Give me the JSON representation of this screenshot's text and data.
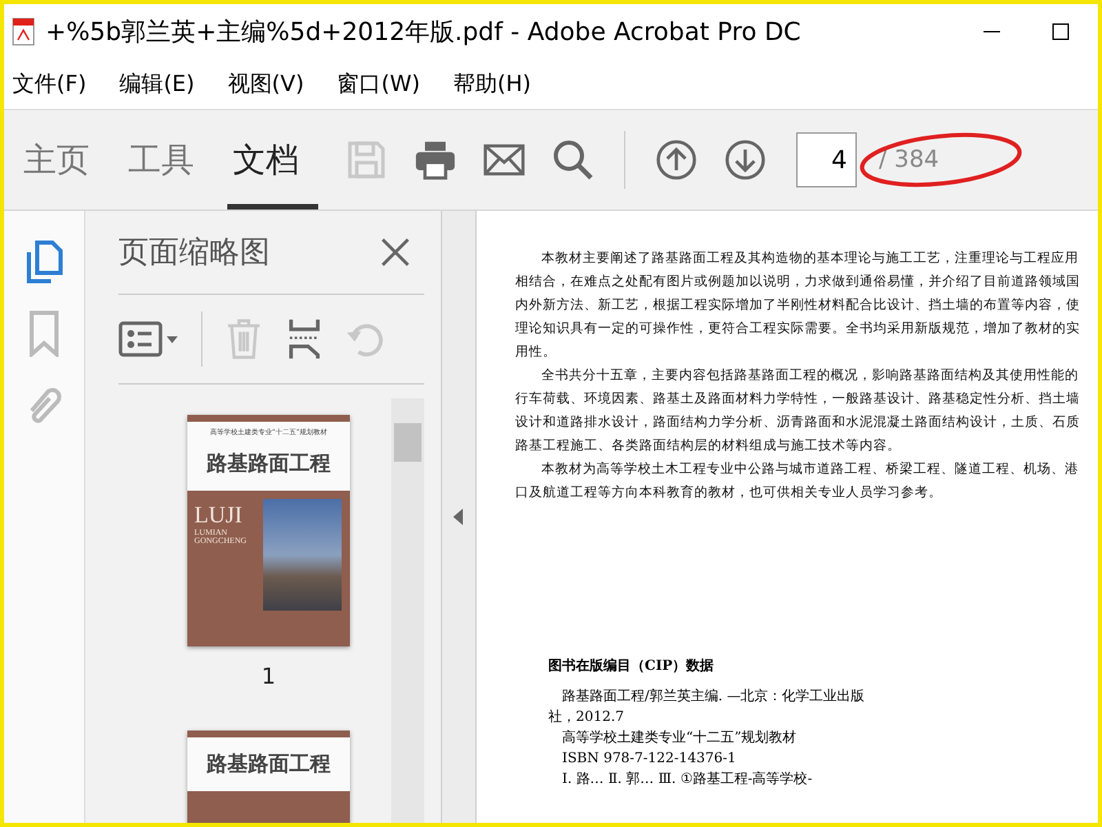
{
  "window": {
    "title": "+%5b郭兰英+主编%5d+2012年版.pdf - Adobe Acrobat Pro DC"
  },
  "menu": [
    "文件(F)",
    "编辑(E)",
    "视图(V)",
    "窗口(W)",
    "帮助(H)"
  ],
  "tabs": [
    {
      "label": "主页",
      "selected": false
    },
    {
      "label": "工具",
      "selected": false
    },
    {
      "label": "文档",
      "selected": true
    }
  ],
  "toolbar": {
    "save_disabled": true,
    "page_value": "4",
    "page_total": "/ 384"
  },
  "side_rail": [
    {
      "kind": "pages",
      "selected": true
    },
    {
      "kind": "bookmark",
      "selected": false
    },
    {
      "kind": "attachment",
      "selected": false
    }
  ],
  "panel": {
    "title": "页面缩略图",
    "delete_disabled": true,
    "rotate_disabled": true
  },
  "thumbnails": [
    {
      "series": "高等学校土建类专业“十二五”规划教材",
      "title": "路基路面工程",
      "latin": [
        "LUJI",
        "LUMIAN",
        "GONGCHENG"
      ],
      "label": "1"
    },
    {
      "title": "路基路面工程"
    }
  ],
  "document": {
    "paragraphs": [
      "本教材主要阐述了路基路面工程及其构造物的基本理论与施工工艺，注重理论与工程应用相结合，在难点之处配有图片或例题加以说明，力求做到通俗易懂，并介绍了目前道路领域国内外新方法、新工艺，根据工程实际增加了半刚性材料配合比设计、挡土墙的布置等内容，使理论知识具有一定的可操作性，更符合工程实际需要。全书均采用新版规范，增加了教材的实用性。",
      "全书共分十五章，主要内容包括路基路面工程的概况，影响路基路面结构及其使用性能的行车荷载、环境因素、路基土及路面材料力学特性，一般路基设计、路基稳定性分析、挡土墙设计和道路排水设计，路面结构力学分析、沥青路面和水泥混凝土路面结构设计，土质、石质路基工程施工、各类路面结构层的材料组成与施工技术等内容。",
      "本教材为高等学校土木工程专业中公路与城市道路工程、桥梁工程、隧道工程、机场、港口及航道工程等方向本科教育的教材，也可供相关专业人员学习参考。"
    ],
    "cip_heading": "图书在版编目（CIP）数据",
    "cip_lines": [
      "路基路面工程/郭兰英主编. —北京：化学工业出版社，2012.7",
      "高等学校土建类专业“十二五”规划教材",
      "ISBN 978-7-122-14376-1",
      "Ⅰ. 路…  Ⅱ. 郭…  Ⅲ. ①路基工程-高等学校-"
    ]
  }
}
